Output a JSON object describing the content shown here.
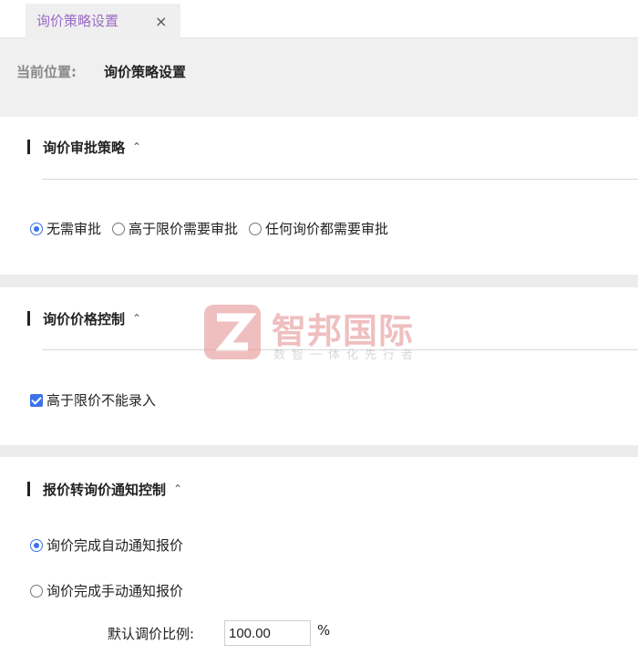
{
  "tab": {
    "label": "询价策略设置",
    "close": "×"
  },
  "breadcrumb": {
    "prefix": "当前位置:",
    "current": "询价策略设置"
  },
  "sections": [
    {
      "title": "询价审批策略",
      "chevron": "^",
      "options": [
        {
          "label": "无需审批",
          "selected": true
        },
        {
          "label": "高于限价需要审批",
          "selected": false
        },
        {
          "label": "任何询价都需要审批",
          "selected": false
        }
      ]
    },
    {
      "title": "询价价格控制",
      "chevron": "^",
      "checkbox": {
        "label": "高于限价不能录入",
        "checked": true
      }
    },
    {
      "title": "报价转询价通知控制",
      "chevron": "^",
      "options": [
        {
          "label": "询价完成自动通知报价",
          "selected": true
        },
        {
          "label": "询价完成手动通知报价",
          "selected": false
        }
      ],
      "ratio": {
        "label": "默认调价比例:",
        "value": "100.00",
        "unit": "%"
      }
    }
  ],
  "watermark": {
    "name": "智邦国际",
    "slogan": "数智一体化先行者"
  },
  "colors": {
    "accent": "#3b73e8",
    "tab_text": "#9a6bc6",
    "watermark": "#e38b8b"
  }
}
